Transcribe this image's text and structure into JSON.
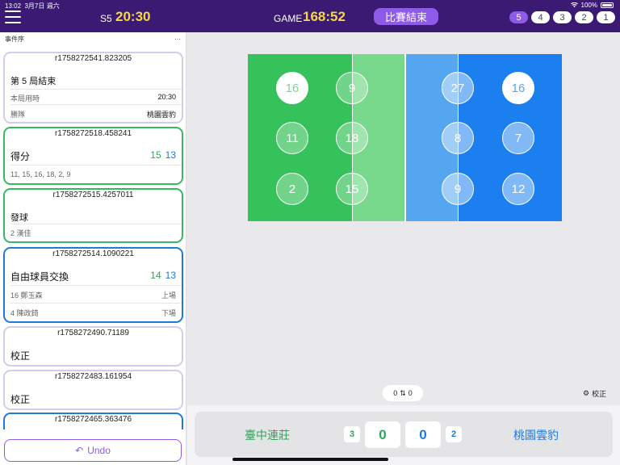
{
  "status": {
    "time": "13:02",
    "date": "3月7日 週六",
    "battery": "100%"
  },
  "header": {
    "set_label": "S5",
    "set_time": "20:30",
    "game_label": "GAME",
    "game_time": "168:52",
    "end_match_label": "比賽結束",
    "sets": [
      "5",
      "4",
      "3",
      "2",
      "1"
    ]
  },
  "panel": {
    "title": "事件序",
    "more": "···"
  },
  "events": [
    {
      "id": "r1758272541.823205",
      "title": "第 5 局結束",
      "rows": [
        {
          "label": "本局用時",
          "value": "20:30"
        },
        {
          "label": "勝隊",
          "value": "桃園雲豹"
        }
      ]
    },
    {
      "id": "r1758272518.458241",
      "title": "得分",
      "score_home": "15",
      "score_away": "13",
      "detail": "11, 15, 16, 18, 2, 9"
    },
    {
      "id": "r1758272515.4257011",
      "title": "發球",
      "detail": "2 漢佳"
    },
    {
      "id": "r1758272514.1090221",
      "title": "自由球員交換",
      "score_home": "14",
      "score_away": "13",
      "rows": [
        {
          "label": "16 鄭玉森",
          "value": "上場"
        },
        {
          "label": "4 陳政錡",
          "value": "下場"
        }
      ]
    },
    {
      "id": "r1758272490.71189",
      "title": "校正"
    },
    {
      "id": "r1758272483.161954",
      "title": "校正"
    },
    {
      "id": "r1758272465.363476"
    }
  ],
  "undo_label": "Undo",
  "court": {
    "home_back": [
      "16",
      "11",
      "2"
    ],
    "home_front": [
      "9",
      "18",
      "15"
    ],
    "away_front": [
      "27",
      "8",
      "9"
    ],
    "away_back": [
      "16",
      "7",
      "12"
    ]
  },
  "swap": {
    "left": "0",
    "right": "0"
  },
  "correct_label": "校正",
  "scoreboard": {
    "home_name": "臺中連莊",
    "away_name": "桃園雲豹",
    "home_sets": "3",
    "away_sets": "2",
    "home_points": "0",
    "away_points": "0"
  },
  "colors": {
    "header": "#3a1a73",
    "accent": "#8e5be8",
    "home": "#2ea55a",
    "away": "#1f7ad8",
    "time": "#f6d845"
  }
}
